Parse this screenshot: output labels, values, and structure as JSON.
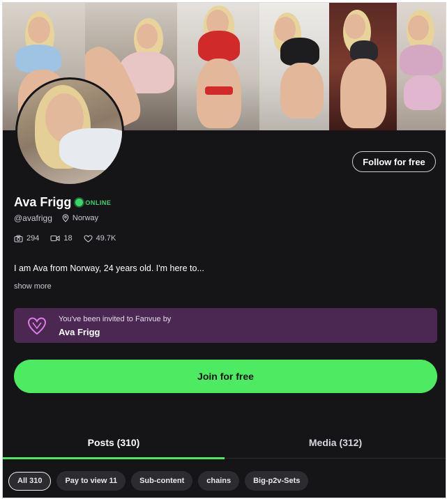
{
  "profile": {
    "name": "Ava Frigg",
    "status": "ONLINE",
    "handle": "@avafrigg",
    "location": "Norway",
    "stats": {
      "photos": "294",
      "videos": "18",
      "likes": "49.7K"
    },
    "bio": "I am Ava from Norway, 24 years old. I'm here to...",
    "show_more": "show more",
    "follow_label": "Follow for free"
  },
  "invite": {
    "text": "You've been invited to Fanvue by",
    "inviter": "Ava Frigg"
  },
  "join_label": "Join for free",
  "tabs": [
    {
      "label": "Posts (310)",
      "active": true
    },
    {
      "label": "Media (312)",
      "active": false
    }
  ],
  "filters": [
    {
      "label": "All 310",
      "active": true
    },
    {
      "label": "Pay to view 11",
      "active": false
    },
    {
      "label": "Sub-content",
      "active": false
    },
    {
      "label": "chains",
      "active": false
    },
    {
      "label": "Big-p2v-Sets",
      "active": false
    }
  ],
  "colors": {
    "accent": "#4ceb61",
    "background": "#151518",
    "invite_bg": "#4a2852",
    "online": "#3bd66b"
  },
  "icons": [
    "location-pin-icon",
    "camera-icon",
    "video-icon",
    "heart-icon",
    "fanvue-heart-icon"
  ]
}
